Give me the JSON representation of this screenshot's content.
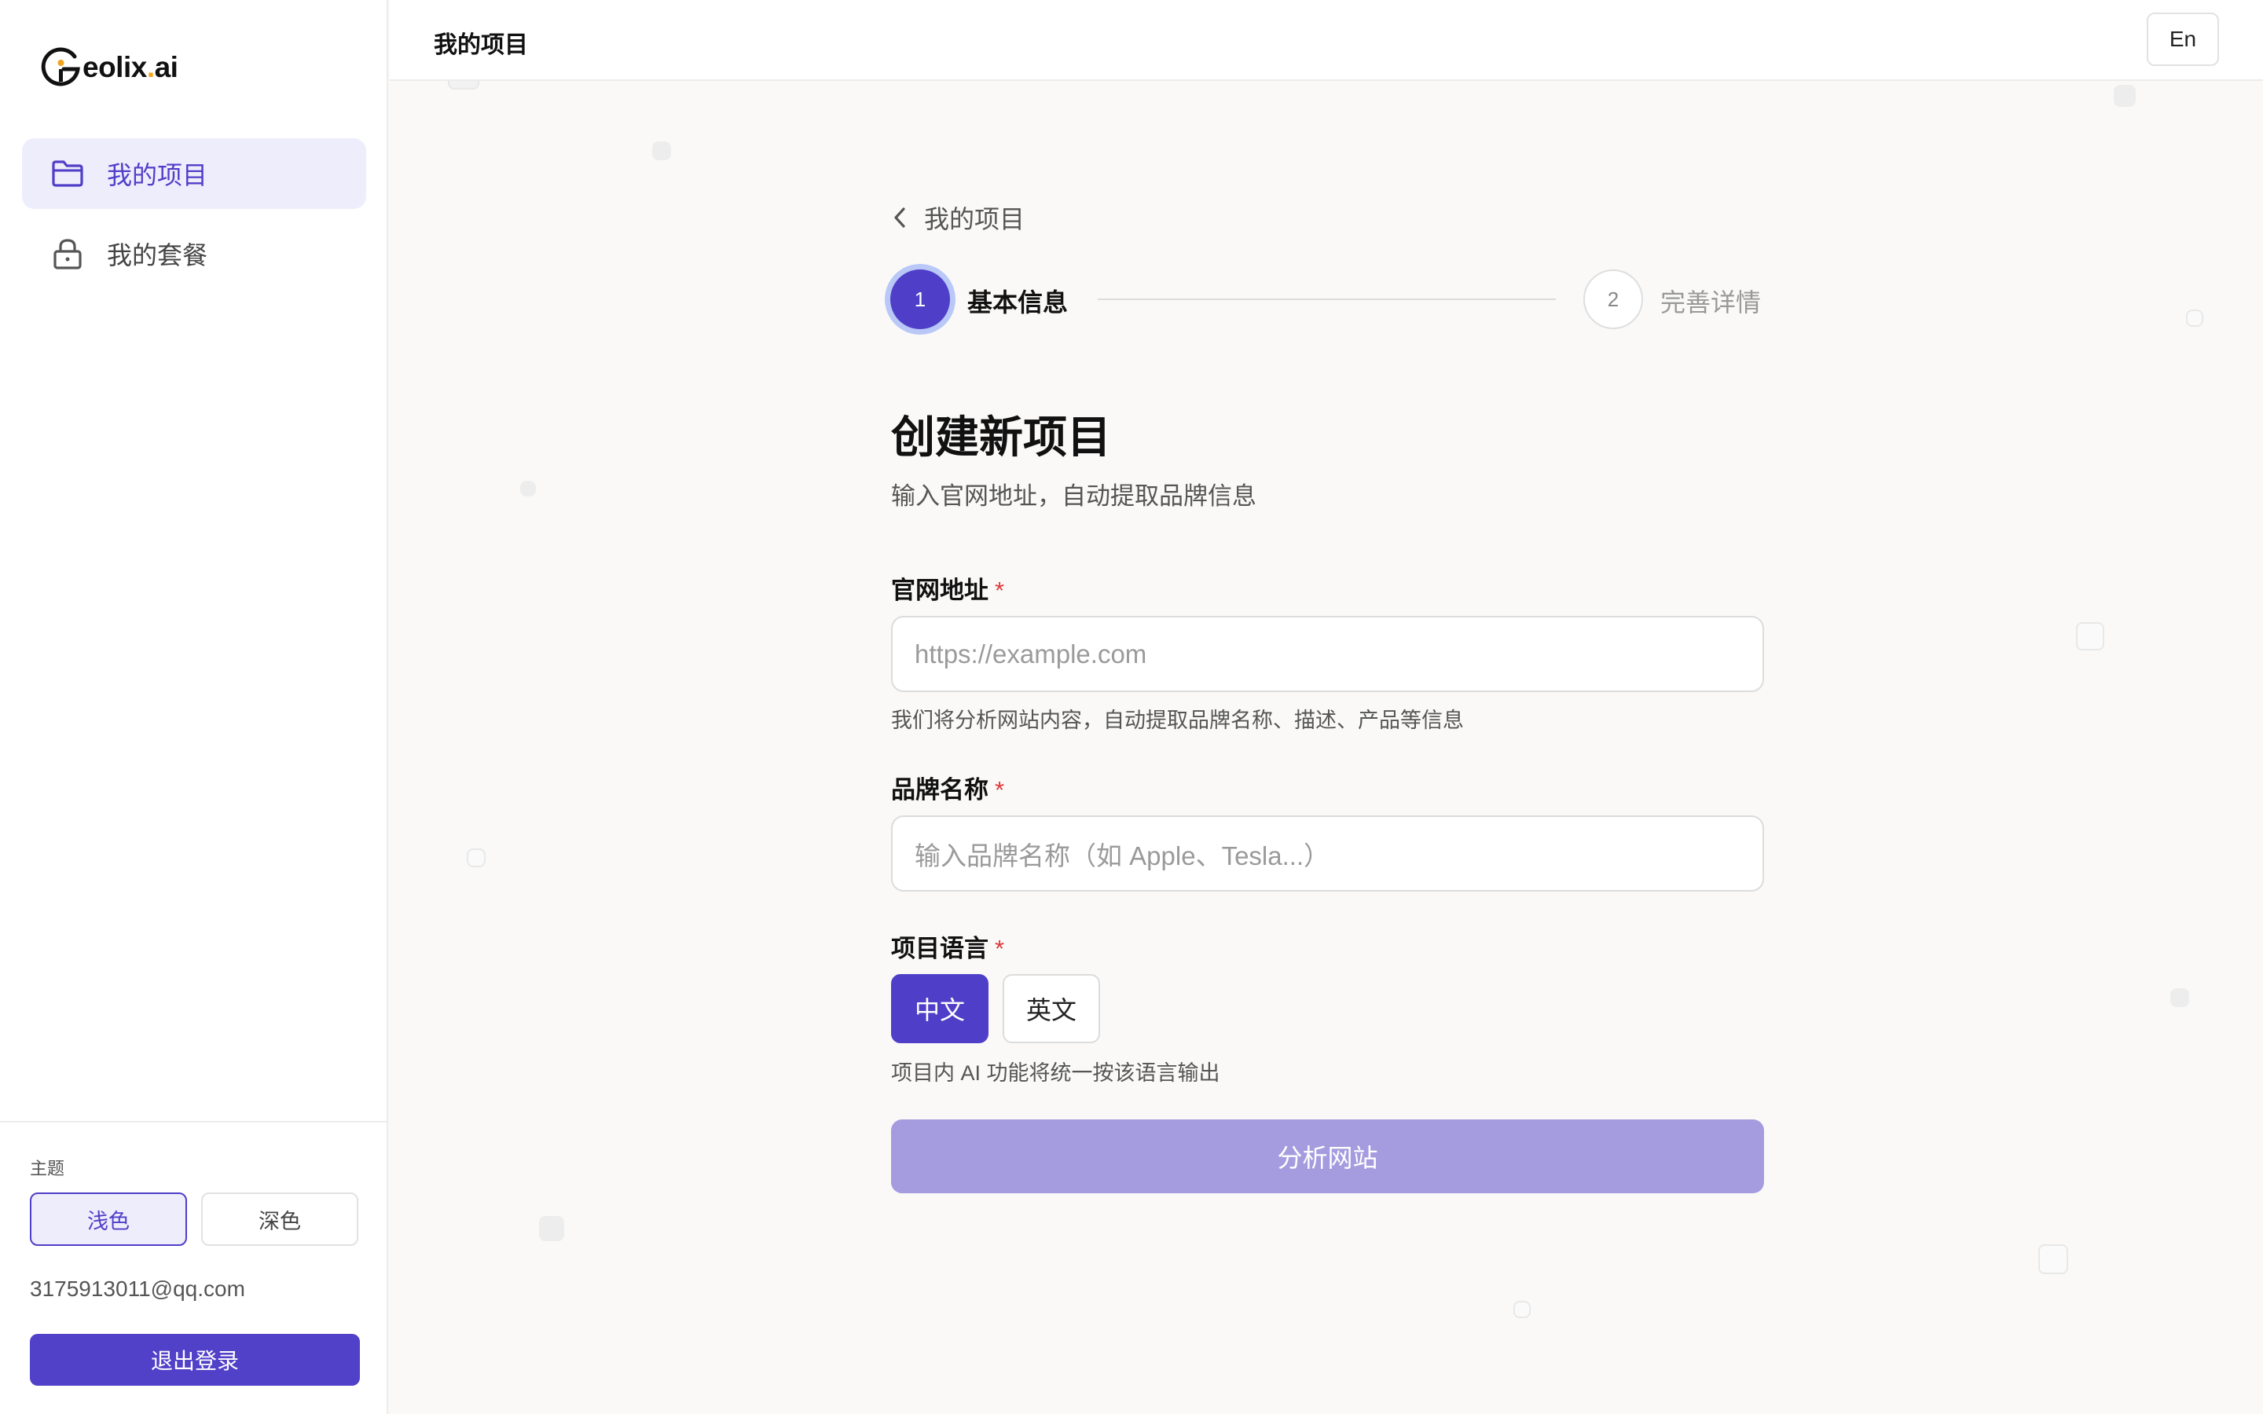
{
  "sidebar": {
    "logo": {
      "text_main": "eolix",
      "text_dot": ".",
      "text_suffix": "ai"
    },
    "nav": [
      {
        "label": "我的项目",
        "icon": "folder-icon",
        "active": true
      },
      {
        "label": "我的套餐",
        "icon": "lock-icon",
        "active": false
      }
    ],
    "theme": {
      "label": "主题",
      "light": "浅色",
      "dark": "深色",
      "selected": "浅色"
    },
    "user_email": "3175913011@qq.com",
    "logout_label": "退出登录"
  },
  "topbar": {
    "title": "我的项目",
    "lang_toggle": "En"
  },
  "main": {
    "back_label": "我的项目",
    "steps": [
      {
        "number": "1",
        "label": "基本信息",
        "active": true
      },
      {
        "number": "2",
        "label": "完善详情",
        "active": false
      }
    ],
    "title": "创建新项目",
    "subtitle": "输入官网地址，自动提取品牌信息",
    "fields": {
      "website": {
        "label": "官网地址",
        "required_mark": "*",
        "placeholder": "https://example.com",
        "value": "",
        "hint": "我们将分析网站内容，自动提取品牌名称、描述、产品等信息"
      },
      "brand": {
        "label": "品牌名称",
        "required_mark": "*",
        "placeholder": "输入品牌名称（如 Apple、Tesla...）",
        "value": ""
      },
      "language": {
        "label": "项目语言",
        "required_mark": "*",
        "options": [
          "中文",
          "英文"
        ],
        "selected": "中文",
        "hint": "项目内 AI 功能将统一按该语言输出"
      }
    },
    "submit_label": "分析网站"
  },
  "colors": {
    "accent": "#4f3fc8",
    "accent_light": "#eeedfc",
    "required": "#e03a3a",
    "submit_disabled": "#a59bdf"
  }
}
